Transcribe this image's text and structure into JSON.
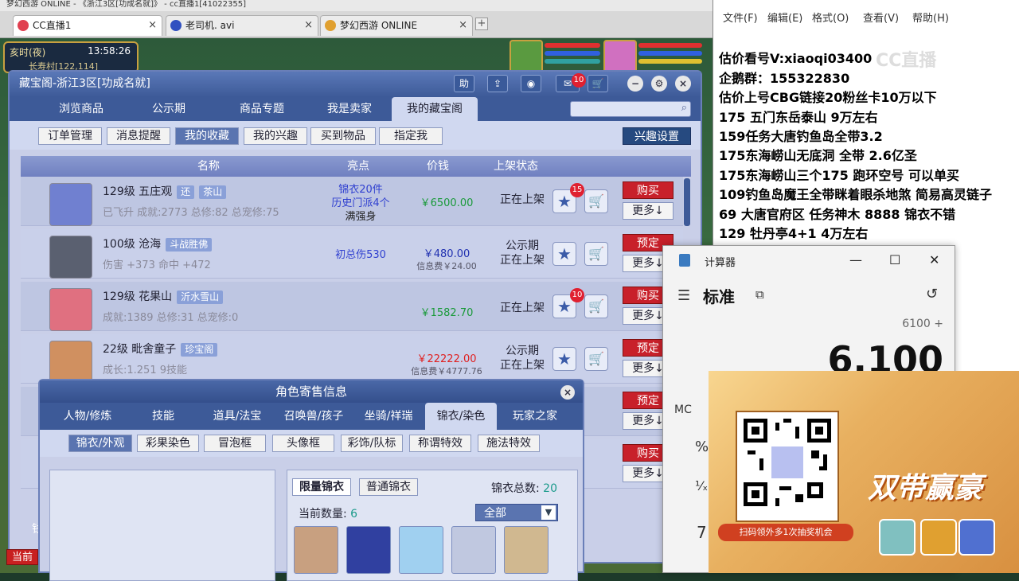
{
  "browser": {
    "top_strip_text": "梦幻西游 ONLINE - 《浙江3区[功成名就]》 - cc直播1[41022355]",
    "tabs": [
      {
        "label": "CC直播1",
        "active": true
      },
      {
        "label": "老司机. avi",
        "active": false
      },
      {
        "label": "梦幻西游 ONLINE",
        "active": false
      }
    ],
    "add_tab": "+"
  },
  "game_hud": {
    "time": "亥时(夜)",
    "clock": "13:58:26",
    "location": "长寿村[122,114]"
  },
  "main_window": {
    "title": "藏宝阁-浙江3区[功成名就]",
    "help_btn": "助",
    "msg_badge": "10",
    "tabs": [
      "浏览商品",
      "公示期",
      "商品专题",
      "我是卖家",
      "我的藏宝阁"
    ],
    "subtabs": [
      "订单管理",
      "消息提醒",
      "我的收藏",
      "我的兴趣",
      "买到物品",
      "指定我"
    ],
    "interest_btn": "兴趣设置",
    "columns": [
      "名称",
      "亮点",
      "价钱",
      "上架状态"
    ],
    "rows": [
      {
        "name": "129级  五庄观",
        "tags": [
          "还",
          "茶山"
        ],
        "sub": "已飞升 成就:2773 总修:82 总宠修:75",
        "highlight": [
          "锦衣20件",
          "历史门派4个",
          "满强身"
        ],
        "price": "￥6500.00",
        "fee": "",
        "state": [
          "正在上架"
        ],
        "badge": "15",
        "action": "购买",
        "more": "更多↓"
      },
      {
        "name": "100级  沧海",
        "tags": [
          "斗战胜佛"
        ],
        "sub": "伤害 +373 命中 +472",
        "highlight": [
          "初总伤530"
        ],
        "price": "￥480.00",
        "fee": "信息费￥24.00",
        "state": [
          "公示期",
          "正在上架"
        ],
        "badge": "",
        "action": "预定",
        "more": "更多↓"
      },
      {
        "name": "129级  花果山",
        "tags": [
          "沂水雪山"
        ],
        "sub": "成就:1389 总修:31 总宠修:0",
        "highlight": [],
        "price": "￥1582.70",
        "fee": "",
        "state": [
          "正在上架"
        ],
        "badge": "10",
        "action": "购买",
        "more": "更多↓"
      },
      {
        "name": "22级  毗舍童子",
        "tags": [
          "珍宝阁"
        ],
        "sub": "成长:1.251 9技能",
        "highlight": [],
        "price": "￥22222.00",
        "fee": "信息费￥4777.76",
        "state": [
          "公示期",
          "正在上架"
        ],
        "badge": "",
        "action": "预定",
        "more": "更多↓"
      },
      {
        "name": "",
        "tags": [],
        "sub": "",
        "highlight": [],
        "price": "",
        "fee": "",
        "state": [],
        "badge": "",
        "action": "预定",
        "more": "更多↓"
      },
      {
        "name": "",
        "tags": [],
        "sub": "",
        "highlight": [],
        "price": "",
        "fee": "",
        "state": [],
        "badge": "",
        "action": "购买",
        "more": "更多↓"
      }
    ]
  },
  "sub_window": {
    "title": "角色寄售信息",
    "categories": [
      "人物/修炼",
      "技能",
      "道具/法宝",
      "召唤兽/孩子",
      "坐骑/祥瑞",
      "锦衣/染色",
      "玩家之家"
    ],
    "fashion_tabs": [
      "锦衣/外观",
      "彩果染色",
      "冒泡框",
      "头像框",
      "彩饰/队标",
      "称谓特效",
      "施法特效"
    ],
    "list_tabs": [
      "限量锦衣",
      "普通锦衣"
    ],
    "total_label": "锦衣总数:",
    "total_value": "20",
    "count_label": "当前数量:",
    "count_value": "6",
    "filter": "全部"
  },
  "bottom_hud": {
    "current": "当前",
    "left_char": "钱"
  },
  "notepad": {
    "menu": [
      "文件(F)",
      "编辑(E)",
      "格式(O)",
      "查看(V)",
      "帮助(H)"
    ],
    "watermark": "CC直播",
    "lines": [
      "估价看号V:xiaoqi03400",
      "企鹅群：155322830",
      "估价上号CBG链接20粉丝卡10万以下",
      "175 五门东岳泰山  9万左右",
      "159任务大唐钓鱼岛全带3.2",
      "175东海崂山无底洞  全带   2.6亿圣",
      "175东海崂山三个175 跑环空号 可以单买",
      "109钓鱼岛魔王全带眯着眼杀地煞 简易高灵链子",
      "69  大唐官府区 任务神木 8888 锦衣不错",
      "129 牡丹亭4+1 4万左右"
    ]
  },
  "calculator": {
    "title": "计算器",
    "mode": "标准",
    "expression": "6100 +",
    "display": "6,100",
    "keys": [
      "MC",
      "%",
      "¹⁄ₓ",
      "7"
    ]
  },
  "ad": {
    "caption": "扫码领外多1次抽奖机会",
    "title": "双带赢豪"
  }
}
